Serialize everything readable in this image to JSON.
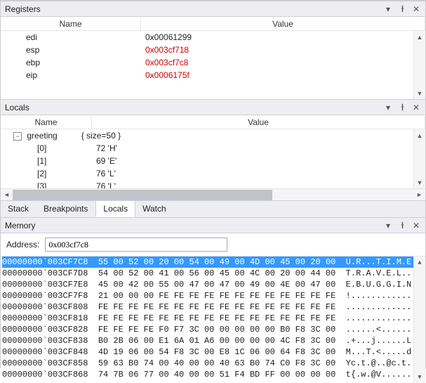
{
  "registers": {
    "title": "Registers",
    "headers": {
      "name": "Name",
      "value": "Value"
    },
    "rows": [
      {
        "name": "edi",
        "value": "0x00061299",
        "changed": false
      },
      {
        "name": "esp",
        "value": "0x003cf718",
        "changed": true
      },
      {
        "name": "ebp",
        "value": "0x003cf7c8",
        "changed": true
      },
      {
        "name": "eip",
        "value": "0x0006175f",
        "changed": true
      }
    ]
  },
  "locals": {
    "title": "Locals",
    "headers": {
      "name": "Name",
      "value": "Value"
    },
    "root": {
      "name": "greeting",
      "summary": "{ size=50 }"
    },
    "children": [
      {
        "idx": "[0]",
        "val": "72 'H'"
      },
      {
        "idx": "[1]",
        "val": "69 'E'"
      },
      {
        "idx": "[2]",
        "val": "76 'L'"
      },
      {
        "idx": "[3]",
        "val": "76 'L'"
      }
    ]
  },
  "tabs": {
    "items": [
      "Stack",
      "Breakpoints",
      "Locals",
      "Watch"
    ],
    "active": 2
  },
  "memory": {
    "title": "Memory",
    "address_label": "Address:",
    "address_value": "0x003cf7c8",
    "lines": [
      {
        "addr": "00000000`003CF7C8",
        "hex": "55 00 52 00 20 00 54 00 49 00 4D 00 45 00 20 00",
        "ascii": "U.R...T.I.M.E...",
        "sel": true
      },
      {
        "addr": "00000000`003CF7D8",
        "hex": "54 00 52 00 41 00 56 00 45 00 4C 00 20 00 44 00",
        "ascii": "T.R.A.V.E.L...D."
      },
      {
        "addr": "00000000`003CF7E8",
        "hex": "45 00 42 00 55 00 47 00 47 00 49 00 4E 00 47 00",
        "ascii": "E.B.U.G.G.I.N.G."
      },
      {
        "addr": "00000000`003CF7F8",
        "hex": "21 00 00 00 FE FE FE FE FE FE FE FE FE FE FE FE",
        "ascii": "!..............."
      },
      {
        "addr": "00000000`003CF808",
        "hex": "FE FE FE FE FE FE FE FE FE FE FE FE FE FE FE FE",
        "ascii": "................"
      },
      {
        "addr": "00000000`003CF818",
        "hex": "FE FE FE FE FE FE FE FE FE FE FE FE FE FE FE FE",
        "ascii": "................"
      },
      {
        "addr": "00000000`003CF828",
        "hex": "FE FE FE FE F0 F7 3C 00 00 00 00 00 B0 F8 3C 00",
        "ascii": "......<.......<."
      },
      {
        "addr": "00000000`003CF838",
        "hex": "B0 2B 06 00 E1 6A 01 A6 00 00 00 00 4C F8 3C 00",
        "ascii": ".+...j......L.<."
      },
      {
        "addr": "00000000`003CF848",
        "hex": "4D 19 06 00 54 F8 3C 00 E8 1C 06 00 64 F8 3C 00",
        "ascii": "M...T.<.....d.<."
      },
      {
        "addr": "00000000`003CF858",
        "hex": "59 63 B0 74 00 40 00 00 40 63 B0 74 C0 F8 3C 00",
        "ascii": "Yc.t.@..@c.t..<."
      },
      {
        "addr": "00000000`003CF868",
        "hex": "74 7B 06 77 00 40 00 00 51 F4 BD FF 00 00 00 00",
        "ascii": "t{.w.@V.........."
      }
    ]
  }
}
